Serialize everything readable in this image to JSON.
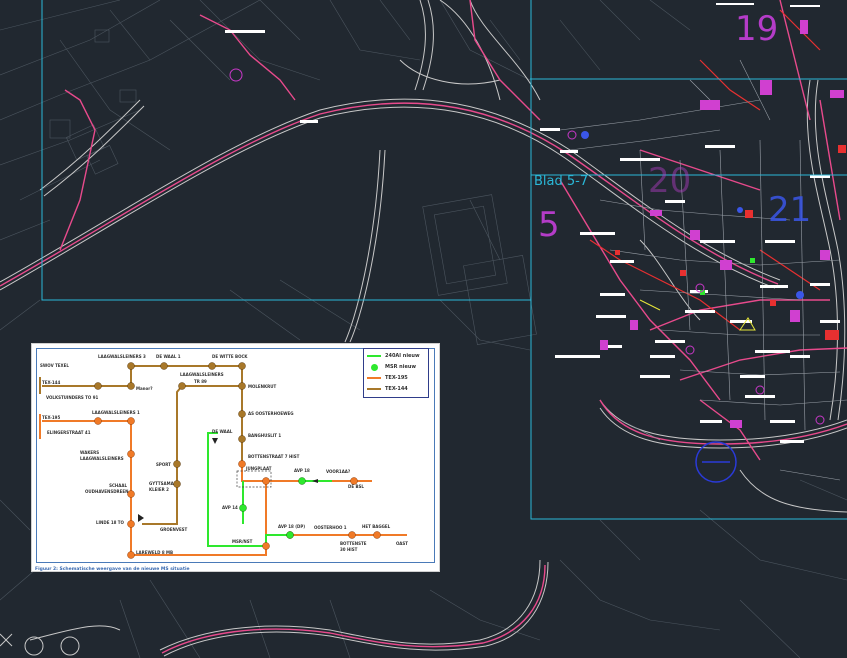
{
  "canvas": {
    "background_color": "#212830",
    "viewport_frame_color": "#2ab8d8",
    "road_color": "#c8c8c8",
    "cable_color": "#e84a8c",
    "sheet_number_color": "#b43cc8"
  },
  "sheet_labels": {
    "sheet_19": "19",
    "sheet_20": "20",
    "sheet_5": "5",
    "sheet_21": "21",
    "blad": "Blad 5-7"
  },
  "inset": {
    "caption": "Figuur 2: Schematische weergave van de nieuwe MS situatie",
    "legend": [
      {
        "label": "240Al nieuw",
        "kind": "line",
        "color": "#2ee82e"
      },
      {
        "label": "MSR nieuw",
        "kind": "dot",
        "color": "#2ee82e"
      },
      {
        "label": "TEX-195",
        "kind": "line",
        "color": "#f07a28"
      },
      {
        "label": "TEX-144",
        "kind": "line",
        "color": "#a8782a"
      }
    ],
    "labels": {
      "tl1": "SWOV TEXEL",
      "tl2": "TEX-144",
      "tl3": "LAAGWALSLEINERS 3",
      "tl4": "DE WAAL 1",
      "tl5": "DE WITTE BOCK",
      "tl6": "Manor?",
      "tl7": "LAAGWALSLEINERS",
      "tl8": "TR 89",
      "tl9": "MOLENKRUT",
      "tl10": "VOLKSTUINDERS TO 91",
      "tl11": "TEX-195",
      "tl12": "LAAGWALSLEINERS 1",
      "tl13": "ELINGERSTRAAT 41",
      "tl14": "AS OOSTERHOEWEG",
      "tl15": "DE WAAL",
      "tl16": "BANGHUSLIT 1",
      "tl17": "WAKERS LAAGWALSLEINERS",
      "tl18": "BOTTENSTRAAT 7 HIST",
      "tl19": "SPORT",
      "tl20": "SCHAAL OUDHAVENSDREEN",
      "tl21": "GYTTSAMA KLEIER 2",
      "tl22": "JUNGPLAAT",
      "tl23": "AVP 18",
      "tl24": "VOOR1AA?",
      "tl25": "DE BSL",
      "tl26": "AVP 14",
      "tl27": "LINDE 18 TO",
      "tl28": "GROENVEST",
      "tl29": "AVP 18 (DP)",
      "tl30": "OOSTERHOO 1",
      "tl31": "HET BAGGEL",
      "tl32": "BOTTENSTE 30 HIST",
      "tl33": "OAST",
      "tl34": "LAREWELD 8 MB",
      "tl35": "MSR/NST"
    }
  }
}
